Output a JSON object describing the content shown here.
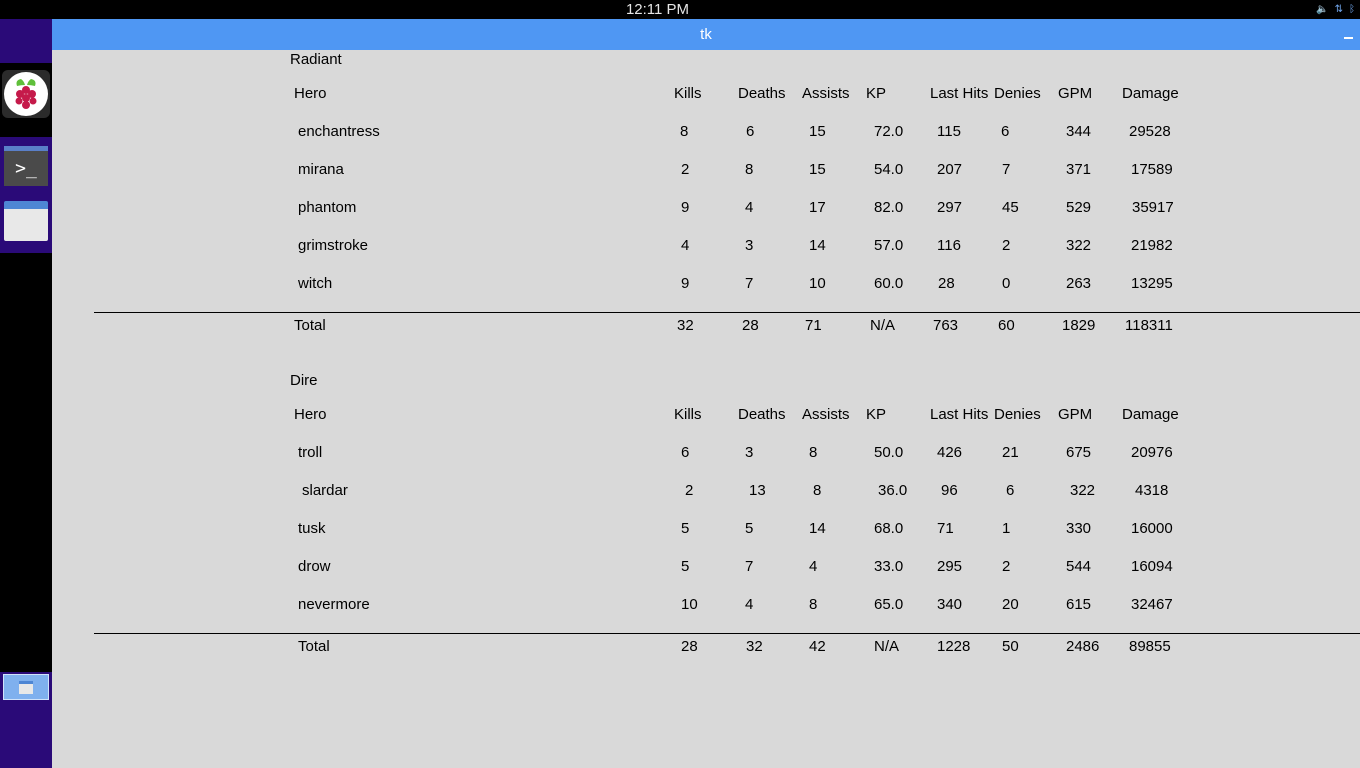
{
  "system": {
    "clock": "12:11 PM",
    "tray_icons": [
      "volume-icon",
      "network-icon",
      "bluetooth-icon"
    ]
  },
  "window": {
    "title": "tk"
  },
  "dock": {
    "items": [
      "raspberry-pi-launcher",
      "terminal-launcher",
      "window-launcher"
    ]
  },
  "columns": [
    "Hero",
    "Kills",
    "Deaths",
    "Assists",
    "KP",
    "Last Hits",
    "Denies",
    "GPM",
    "Damage"
  ],
  "teams": [
    {
      "name": "Radiant",
      "players": [
        [
          "enchantress",
          "8",
          "6",
          "15",
          "72.0",
          "115",
          "6",
          "344",
          "29528"
        ],
        [
          "mirana",
          "2",
          "8",
          "15",
          "54.0",
          "207",
          "7",
          "371",
          "17589"
        ],
        [
          "phantom",
          "9",
          "4",
          "17",
          "82.0",
          "297",
          "45",
          "529",
          "35917"
        ],
        [
          "grimstroke",
          "4",
          "3",
          "14",
          "57.0",
          "116",
          "2",
          "322",
          "21982"
        ],
        [
          "witch",
          "9",
          "7",
          "10",
          "60.0",
          "28",
          "0",
          "263",
          "13295"
        ]
      ],
      "total": [
        "Total",
        "32",
        "28",
        "71",
        "N/A",
        "763",
        "60",
        "1829",
        "118311"
      ]
    },
    {
      "name": "Dire",
      "players": [
        [
          "troll",
          "6",
          "3",
          "8",
          "50.0",
          "426",
          "21",
          "675",
          "20976"
        ],
        [
          "slardar",
          "2",
          "13",
          "8",
          "36.0",
          "96",
          "6",
          "322",
          "4318"
        ],
        [
          "tusk",
          "5",
          "5",
          "14",
          "68.0",
          "71",
          "1",
          "330",
          "16000"
        ],
        [
          "drow",
          "5",
          "7",
          "4",
          "33.0",
          "295",
          "2",
          "544",
          "16094"
        ],
        [
          "nevermore",
          "10",
          "4",
          "8",
          "65.0",
          "340",
          "20",
          "615",
          "32467"
        ]
      ],
      "total": [
        "Total",
        "28",
        "32",
        "42",
        "N/A",
        "1228",
        "50",
        "2486",
        "89855"
      ]
    }
  ]
}
